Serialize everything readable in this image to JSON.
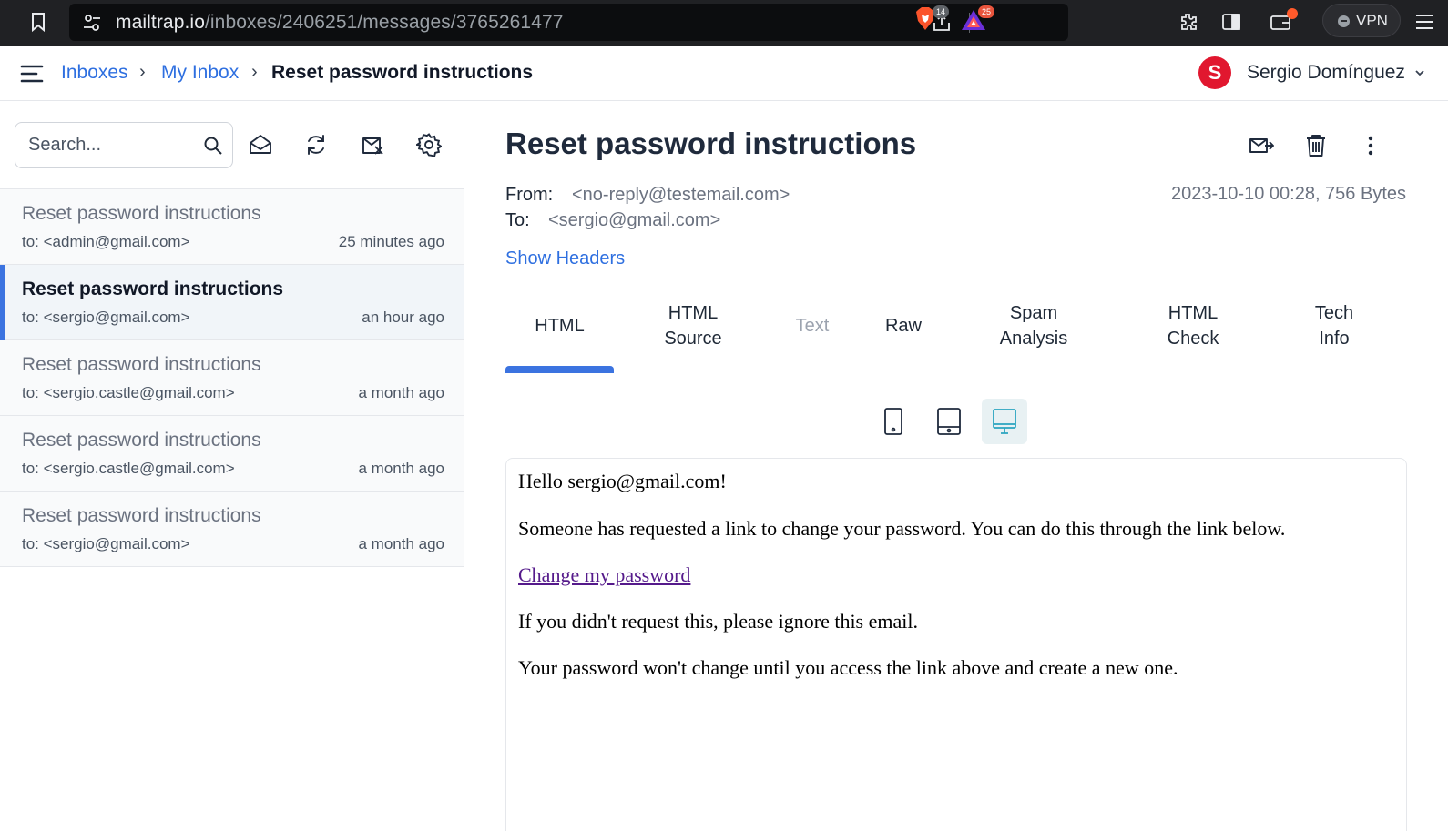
{
  "browser": {
    "url_host": "mailtrap.io",
    "url_path": "/inboxes/2406251/messages/3765261477",
    "shields_count": "14",
    "rewards_count": "25",
    "vpn_label": "VPN"
  },
  "header": {
    "breadcrumbs": [
      "Inboxes",
      "My Inbox",
      "Reset password instructions"
    ],
    "breadcrumb_sep": "›",
    "user_initial": "S",
    "user_name": "Sergio Domínguez"
  },
  "toolbar": {
    "search_placeholder": "Search..."
  },
  "messages": [
    {
      "subject": "Reset password instructions",
      "to": "to: <admin@gmail.com>",
      "time": "25 minutes ago",
      "active": false
    },
    {
      "subject": "Reset password instructions",
      "to": "to: <sergio@gmail.com>",
      "time": "an hour ago",
      "active": true
    },
    {
      "subject": "Reset password instructions",
      "to": "to: <sergio.castle@gmail.com>",
      "time": "a month ago",
      "active": false
    },
    {
      "subject": "Reset password instructions",
      "to": "to: <sergio.castle@gmail.com>",
      "time": "a month ago",
      "active": false
    },
    {
      "subject": "Reset password instructions",
      "to": "to: <sergio@gmail.com>",
      "time": "a month ago",
      "active": false
    }
  ],
  "message": {
    "title": "Reset password instructions",
    "from_label": "From:",
    "from": "<no-reply@testemail.com>",
    "to_label": "To:",
    "to": "<sergio@gmail.com>",
    "meta": "2023-10-10 00:28, 756 Bytes",
    "show_headers": "Show Headers"
  },
  "tabs": [
    {
      "line1": "HTML",
      "line2": "",
      "active": true,
      "disabled": false
    },
    {
      "line1": "HTML",
      "line2": "Source",
      "active": false,
      "disabled": false
    },
    {
      "line1": "Text",
      "line2": "",
      "active": false,
      "disabled": true
    },
    {
      "line1": "Raw",
      "line2": "",
      "active": false,
      "disabled": false
    },
    {
      "line1": "Spam",
      "line2": "Analysis",
      "active": false,
      "disabled": false
    },
    {
      "line1": "HTML",
      "line2": "Check",
      "active": false,
      "disabled": false
    },
    {
      "line1": "Tech",
      "line2": "Info",
      "active": false,
      "disabled": false
    }
  ],
  "device_view": "desktop",
  "email_body": {
    "greeting": "Hello sergio@gmail.com!",
    "line1": "Someone has requested a link to change your password. You can do this through the link below.",
    "link_text": "Change my password",
    "line2": "If you didn't request this, please ignore this email.",
    "line3": "Your password won't change until you access the link above and create a new one."
  },
  "colors": {
    "accent": "#3b73e0",
    "link": "#2e6fe0",
    "avatar": "#e1172f",
    "chrome_bg": "#202124"
  }
}
